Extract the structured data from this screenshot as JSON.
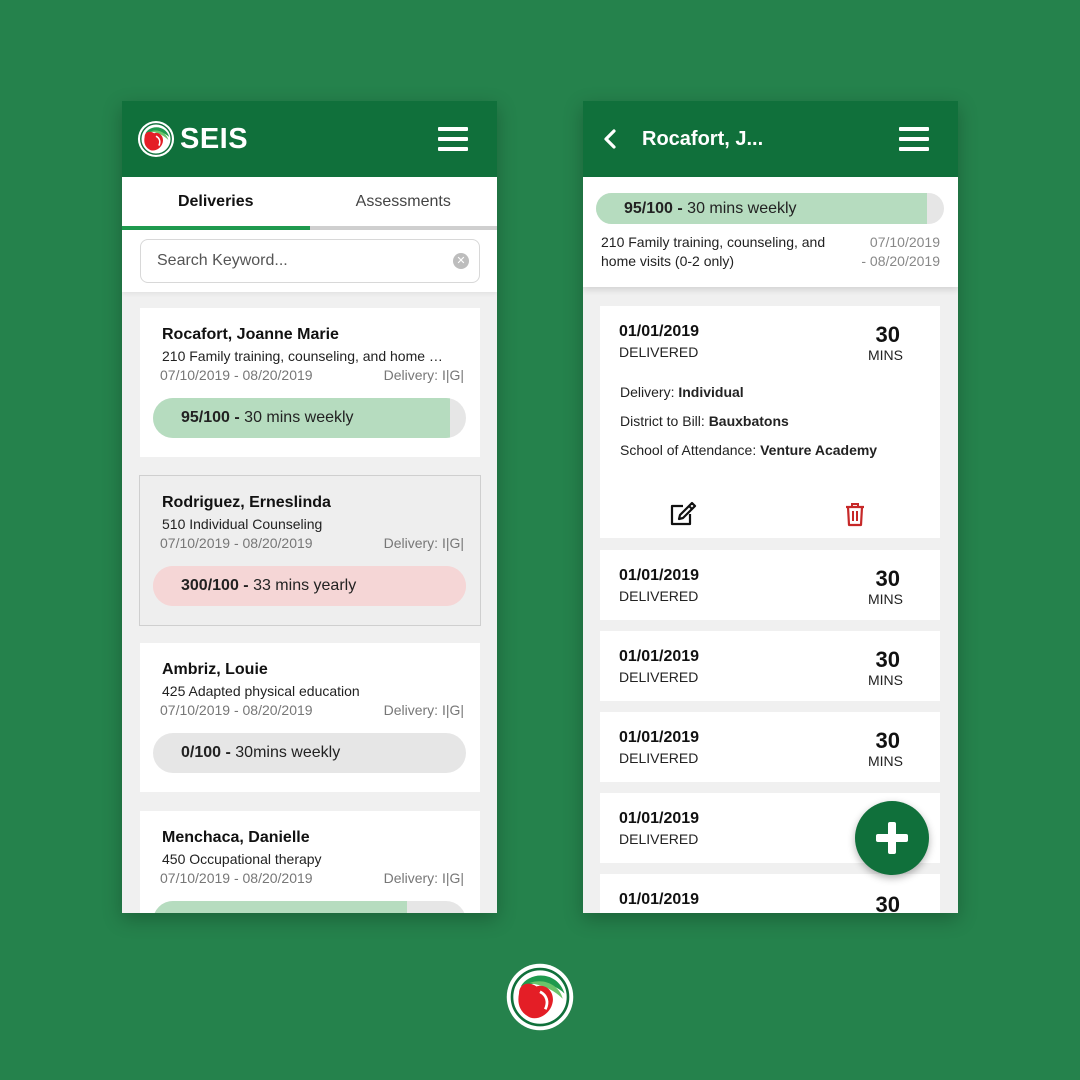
{
  "app": {
    "name": "SEIS"
  },
  "list_screen": {
    "tabs": [
      {
        "label": "Deliveries",
        "active": true
      },
      {
        "label": "Assessments",
        "active": false
      }
    ],
    "search": {
      "placeholder": "Search Keyword..."
    },
    "students": [
      {
        "name": "Rocafort, Joanne Marie",
        "service": "210 Family training, counseling, and home …",
        "dates": "07/10/2019 - 08/20/2019",
        "delivery": "Delivery: I|G|",
        "progress_value": "95/100 -",
        "progress_text": "30 mins weekly",
        "progress_fraction": 0.95,
        "selected": false
      },
      {
        "name": "Rodriguez, Erneslinda",
        "service": "510 Individual Counseling",
        "dates": "07/10/2019 - 08/20/2019",
        "delivery": "Delivery: I|G|",
        "progress_value": "300/100 -",
        "progress_text": "33 mins yearly",
        "progress_fraction": 1.0,
        "selected": true
      },
      {
        "name": "Ambriz, Louie",
        "service": "425 Adapted physical education",
        "dates": "07/10/2019 - 08/20/2019",
        "delivery": "Delivery: I|G|",
        "progress_value": "0/100 -",
        "progress_text": "30mins weekly",
        "progress_fraction": 0.0,
        "selected": false
      },
      {
        "name": "Menchaca, Danielle",
        "service": "450 Occupational therapy",
        "dates": "07/10/2019 - 08/20/2019",
        "delivery": "Delivery: I|G|",
        "progress_value": "",
        "progress_text": "",
        "progress_fraction": 0.81,
        "selected": false
      }
    ]
  },
  "detail_screen": {
    "title": "Rocafort, J...",
    "summary": {
      "progress_value": "95/100 -",
      "progress_text": "30 mins weekly",
      "progress_fraction": 0.95,
      "service": "210 Family training, counseling, and home visits (0-2 only)",
      "date_start": "07/10/2019",
      "date_end": "- 08/20/2019"
    },
    "deliveries": [
      {
        "date": "01/01/2019",
        "status": "DELIVERED",
        "minutes": "30",
        "unit": "MINS",
        "expanded": true,
        "details": [
          {
            "label": "Delivery:",
            "value": "Individual"
          },
          {
            "label": "District to Bill:",
            "value": "Bauxbatons"
          },
          {
            "label": "School of Attendance:",
            "value": "Venture Academy"
          }
        ]
      },
      {
        "date": "01/01/2019",
        "status": "DELIVERED",
        "minutes": "30",
        "unit": "MINS",
        "expanded": false
      },
      {
        "date": "01/01/2019",
        "status": "DELIVERED",
        "minutes": "30",
        "unit": "MINS",
        "expanded": false
      },
      {
        "date": "01/01/2019",
        "status": "DELIVERED",
        "minutes": "30",
        "unit": "MINS",
        "expanded": false
      },
      {
        "date": "01/01/2019",
        "status": "DELIVERED",
        "minutes": "",
        "unit": "",
        "expanded": false
      },
      {
        "date": "01/01/2019",
        "status": "",
        "minutes": "30",
        "unit": "",
        "expanded": false
      }
    ]
  },
  "icons": {
    "menu": "hamburger-menu-icon",
    "back": "chevron-left-icon",
    "clear": "clear-search-icon",
    "edit": "edit-icon",
    "delete": "trash-icon",
    "add": "plus-icon",
    "logo": "seis-logo-icon"
  },
  "colors": {
    "background": "#25824c",
    "header": "#10703b",
    "tab_indicator": "#1f9a4e",
    "progress_fill": "#b6dcbf",
    "progress_over": "#f5d6d6",
    "delete_red": "#c62828"
  }
}
